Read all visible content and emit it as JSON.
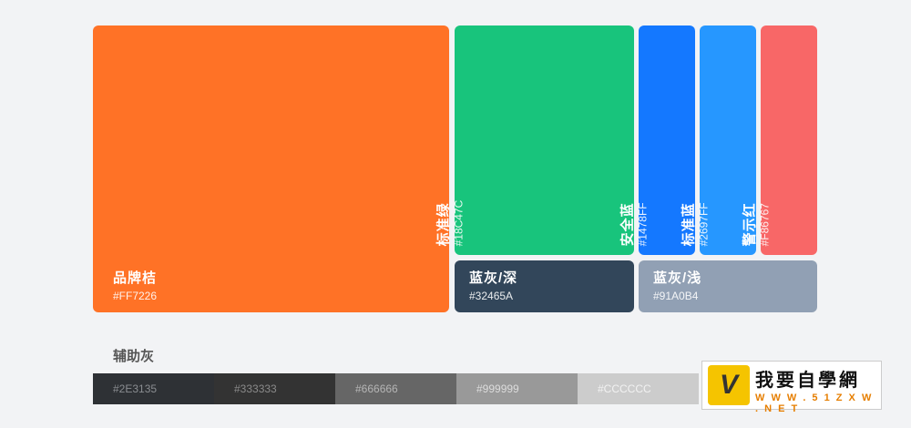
{
  "palette": {
    "brand_orange": {
      "name": "品牌桔",
      "hex": "#FF7226"
    },
    "standard_green": {
      "name": "标准绿",
      "hex": "#18C47C"
    },
    "safe_blue": {
      "name": "安全蓝",
      "hex": "#1478FF"
    },
    "standard_blue": {
      "name": "标准蓝",
      "hex": "#2697FF"
    },
    "warning_red": {
      "name": "警示红",
      "hex": "#F86767"
    },
    "blue_gray_dark": {
      "name": "蓝灰/深",
      "hex": "#32465A"
    },
    "blue_gray_light": {
      "name": "蓝灰/浅",
      "hex": "#91A0B4"
    }
  },
  "auxiliary": {
    "title": "辅助灰",
    "grays": [
      "#2E3135",
      "#333333",
      "#666666",
      "#999999",
      "#CCCCCC"
    ]
  },
  "watermark": {
    "title": "我要自學網",
    "url": "W W W . 5 1 Z X W . N E T",
    "badge": "V"
  }
}
